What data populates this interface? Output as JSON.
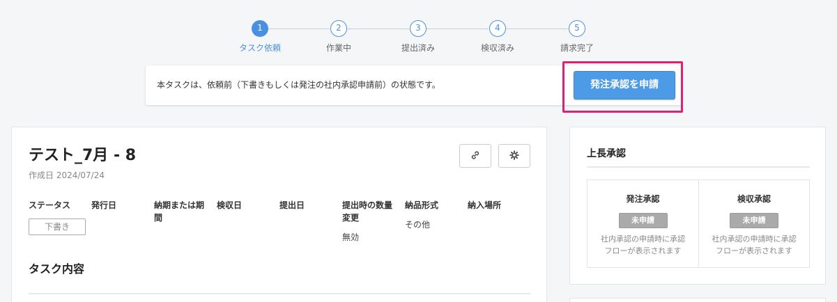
{
  "stepper": {
    "steps": [
      {
        "num": "1",
        "label": "タスク依頼"
      },
      {
        "num": "2",
        "label": "作業中"
      },
      {
        "num": "3",
        "label": "提出済み"
      },
      {
        "num": "4",
        "label": "検収済み"
      },
      {
        "num": "5",
        "label": "請求完了"
      }
    ],
    "active_step": 1
  },
  "banner": {
    "message": "本タスクは、依頼前（下書きもしくは発注の社内承認申請前）の状態です。",
    "request_button": "発注承認を申請"
  },
  "task": {
    "title": "テスト_7月 - 8",
    "created": "作成日 2024/07/24",
    "actions": {
      "link": "link-icon",
      "settings": "gear-icon"
    },
    "fields": {
      "status": {
        "header": "ステータス",
        "value": "下書き"
      },
      "issue_date": {
        "header": "発行日",
        "value": ""
      },
      "deadline": {
        "header_line1": "納期または期",
        "header_line2": "間",
        "value": ""
      },
      "inspection_date": {
        "header": "検収日",
        "value": ""
      },
      "submit_date": {
        "header": "提出日",
        "value": ""
      },
      "qty_change": {
        "header_line1": "提出時の数量",
        "header_line2": "変更",
        "value": "無効"
      },
      "delivery_format": {
        "header": "納品形式",
        "value": "その他"
      },
      "delivery_place": {
        "header": "納入場所",
        "value": ""
      }
    },
    "section_title": "タスク内容"
  },
  "approval": {
    "title": "上長承認",
    "order": {
      "header": "発注承認",
      "badge": "未申請",
      "note_line1": "社内承認の申請時に承認",
      "note_line2": "フローが表示されます"
    },
    "inspection": {
      "header": "検収承認",
      "badge": "未申請",
      "note_line1": "社内承認の申請時に承認",
      "note_line2": "フローが表示されます"
    }
  },
  "colors": {
    "accent": "#4a90e2",
    "button": "#4d9be6",
    "highlight": "#e0226e"
  }
}
